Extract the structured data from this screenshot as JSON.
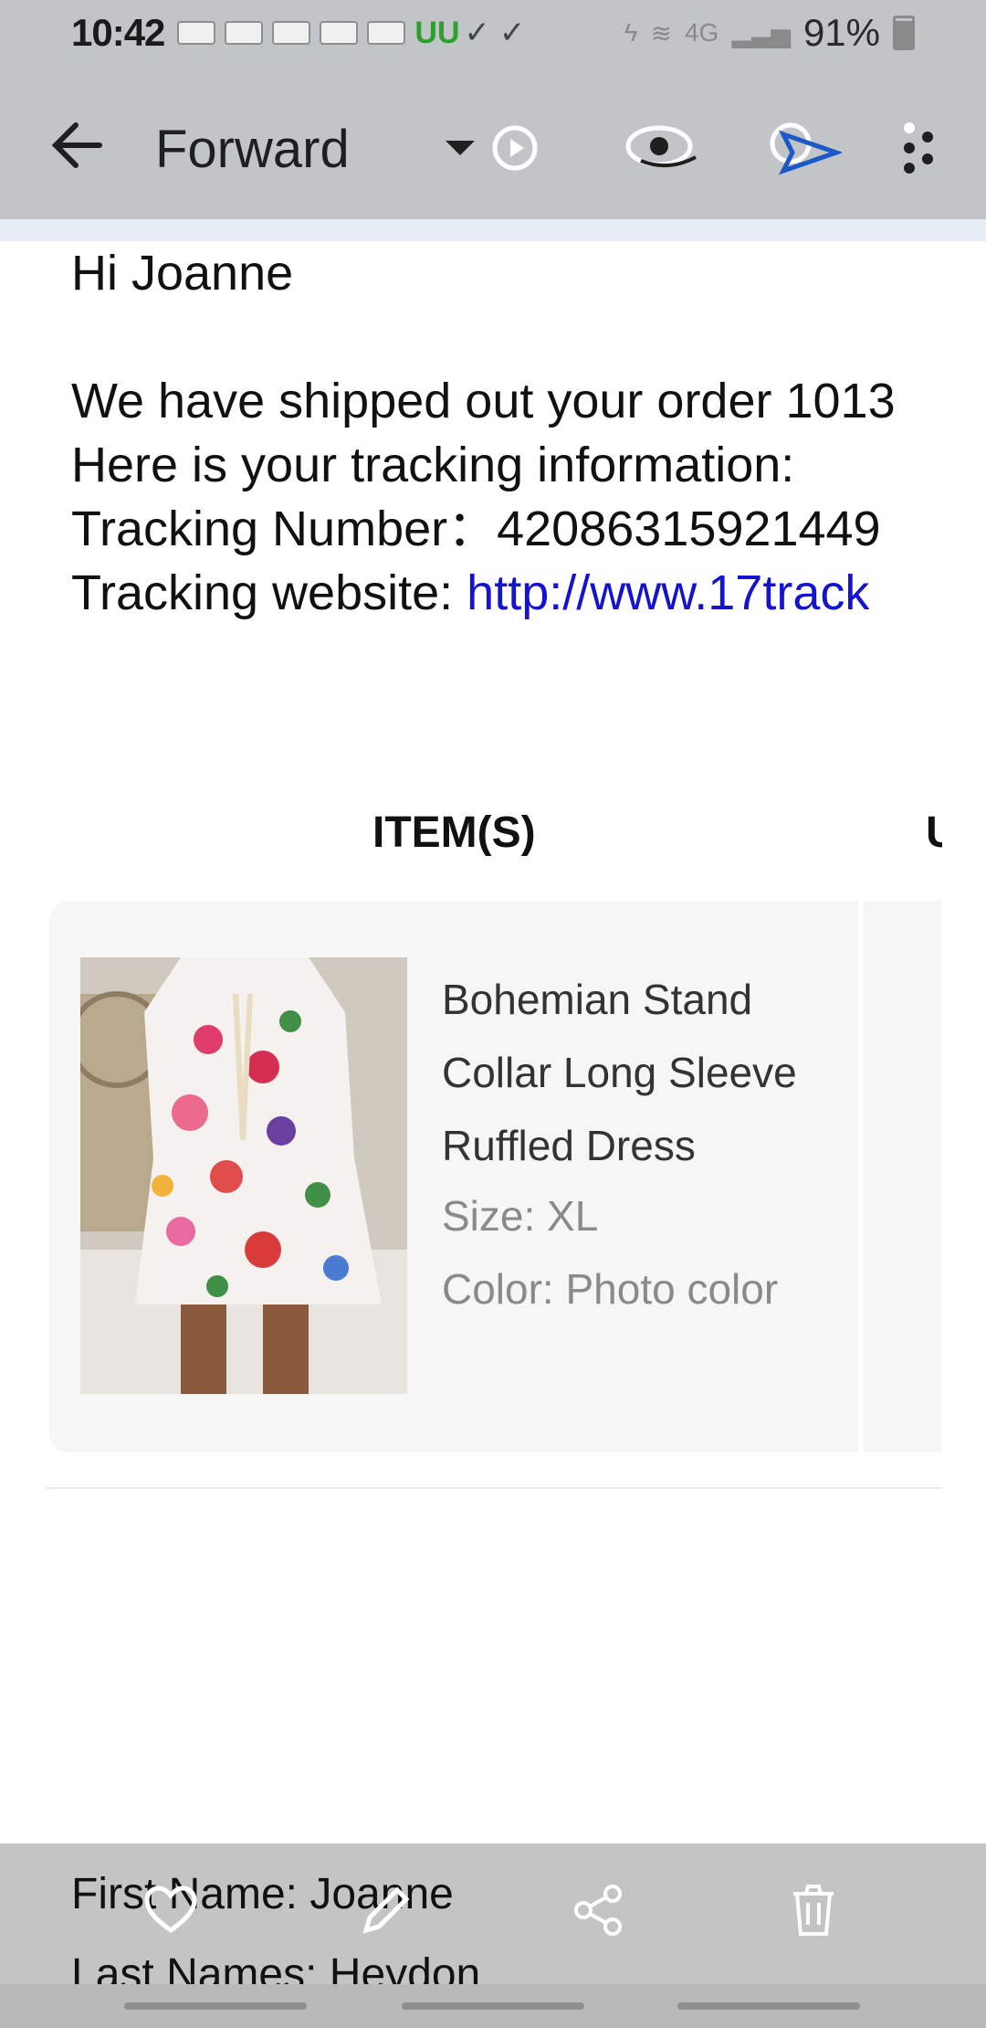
{
  "status_bar": {
    "time": "10:42",
    "battery": "91%",
    "network": "4G"
  },
  "toolbar": {
    "title": "Forward",
    "back_icon": "back-arrow-icon",
    "dropdown_icon": "dropdown-triangle-icon",
    "icons": [
      "replay-icon",
      "eye-icon",
      "send-icon",
      "more-vert-icon"
    ]
  },
  "email": {
    "greeting": "Hi Joanne",
    "line1": "We have shipped out your order 1013",
    "line2": "Here is your tracking information:",
    "line3": "Tracking Number：42086315921449",
    "line4_label": "Tracking website: ",
    "line4_link": "http://www.17track",
    "items_header": "ITEM(S)",
    "next_col_header": "U"
  },
  "product": {
    "name": "Bohemian Stand Collar Long Sleeve Ruffled Dress",
    "size": "Size: XL",
    "color": "Color: Photo color"
  },
  "bottom": {
    "first_name": "First Name: Joanne",
    "last_name": "Last Names: Heydon",
    "icons": [
      "heart-icon",
      "pencil-icon",
      "share-icon",
      "trash-icon"
    ]
  }
}
